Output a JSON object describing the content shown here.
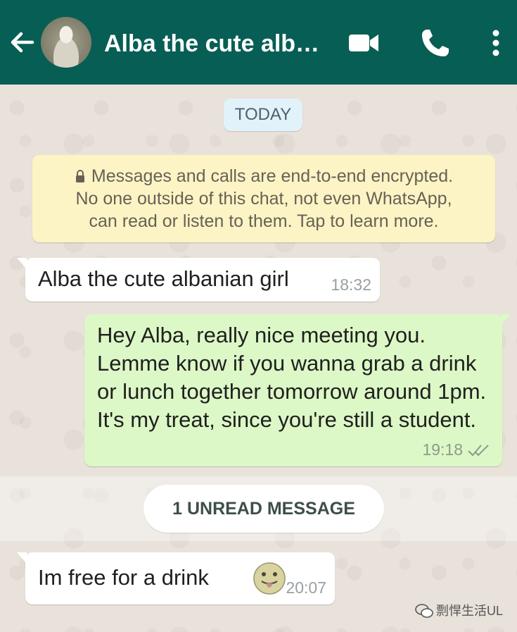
{
  "header": {
    "title": "Alba the cute alb…",
    "back_icon": "arrow-left-icon",
    "video_icon": "video-camera-icon",
    "call_icon": "phone-icon",
    "more_icon": "more-vertical-icon",
    "background_color": "#075e54"
  },
  "date_divider": "TODAY",
  "encryption_notice": {
    "icon": "lock-icon",
    "line1": "Messages and calls are end-to-end encrypted.",
    "line2": "No one outside of this chat, not even WhatsApp,",
    "line3": "can read or listen to them. Tap to learn more."
  },
  "messages": [
    {
      "direction": "incoming",
      "text": "Alba the cute albanian girl",
      "time": "18:32"
    },
    {
      "direction": "outgoing",
      "text": "Hey Alba, really nice meeting you. Lemme know if you wanna grab a drink or lunch together tomorrow around 1pm. It's my treat, since you're still a student.",
      "time": "19:18",
      "status_icon": "double-check-icon"
    },
    {
      "direction": "incoming",
      "text": "Im free for a drink",
      "emoji": "tongue-out-face-icon",
      "time": "20:07"
    }
  ],
  "unread_divider": "1 UNREAD MESSAGE",
  "watermark": {
    "icon": "wechat-logo-icon",
    "text": "剽悍生活UL"
  },
  "colors": {
    "outgoing_bubble": "#dcf8c6",
    "incoming_bubble": "#ffffff",
    "notice_bubble": "#fdf4c5",
    "date_pill": "#e1f2fb"
  }
}
